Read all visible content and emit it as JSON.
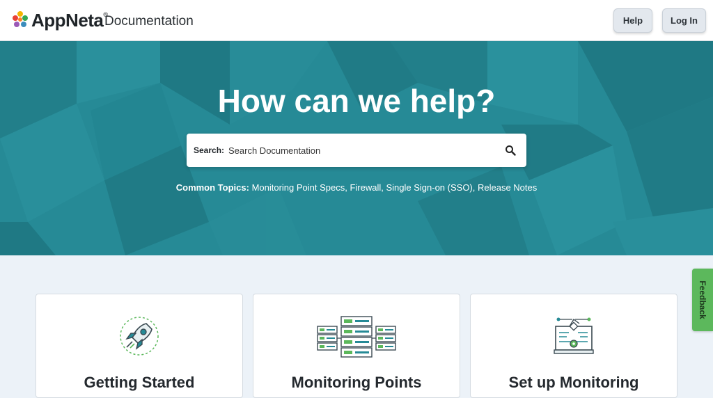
{
  "header": {
    "brand": "AppNeta",
    "brand_mark": "®",
    "subtitle": "Documentation",
    "help_label": "Help",
    "login_label": "Log In"
  },
  "hero": {
    "title": "How can we help?",
    "search_label": "Search:",
    "search_placeholder": "Search Documentation",
    "topics_label": "Common Topics:",
    "topics": "Monitoring Point Specs, Firewall, Single Sign-on (SSO), Release Notes"
  },
  "cards": [
    {
      "title": "Getting Started",
      "icon": "rocket-icon"
    },
    {
      "title": "Monitoring Points",
      "icon": "servers-icon"
    },
    {
      "title": "Set up Monitoring",
      "icon": "monitor-setup-icon"
    }
  ],
  "feedback_label": "Feedback",
  "colors": {
    "hero": "#268a96",
    "accent_green": "#5cb85c",
    "header": "#ffffff"
  }
}
